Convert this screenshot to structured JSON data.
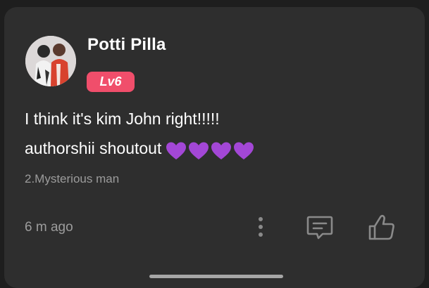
{
  "comment_card": {
    "user": {
      "name": "Potti Pilla",
      "level": "Lv6",
      "avatar_icon": "avatar-photo"
    },
    "text_lines": [
      "I think it's kim John right!!!!!",
      "authorshii shoutout"
    ],
    "emoji": "💜💜💜💜",
    "reference": "2.Mysterious man",
    "timestamp": "6 m ago",
    "actions": {
      "more_icon": "more-vertical-icon",
      "reply_icon": "comment-reply-icon",
      "like_icon": "thumbs-up-icon"
    }
  },
  "colors": {
    "background": "#1e1e1e",
    "card": "#2e2e2e",
    "level_badge": "#f04e6b",
    "heart": "#a347d6",
    "muted_text": "#9c9c9c"
  }
}
